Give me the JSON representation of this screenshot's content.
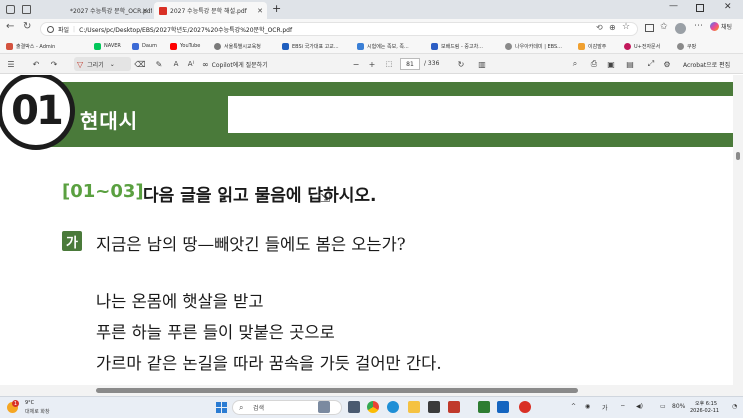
{
  "browser": {
    "tabs": [
      {
        "title": "*2027 수능특강 문학_OCR.pdf",
        "active": false
      },
      {
        "title": "2027 수능특강 문학 해설.pdf",
        "active": true
      }
    ],
    "new_tab": "+",
    "url_prefix": "파일",
    "url": "C:/Users/pc/Desktop/EBS/2027학년도/2027%20수능특강%20문학_OCR.pdf",
    "right_label": "채팅",
    "bookmarks": [
      {
        "label": "출결박스 - Admin",
        "color": "#d4533f"
      },
      {
        "label": "NAVER",
        "color": "#03c75a"
      },
      {
        "label": "Daum",
        "color": "#3d6bd6"
      },
      {
        "label": "YouTube",
        "color": "#ff0000"
      },
      {
        "label": "서울특별시교육청",
        "color": "#7a7a7a"
      },
      {
        "label": "EBSi 국가대표 고교...",
        "color": "#1f5fbf"
      },
      {
        "label": "시험에는 족보, 족...",
        "color": "#3a7fd6"
      },
      {
        "label": "보배드림 - 중고차...",
        "color": "#2c5ec4"
      },
      {
        "label": "나우아카데미 | EBS...",
        "color": "#8a8a8a"
      },
      {
        "label": "이감발주",
        "color": "#f0a030"
      },
      {
        "label": "U+전자문서",
        "color": "#c2185b"
      },
      {
        "label": "쿠팡",
        "color": "#8a8a8a"
      }
    ]
  },
  "pdf_toolbar": {
    "draw_label": "그리기",
    "copilot_label": "Copilot에게 질문하기",
    "zoom_minus": "−",
    "zoom_plus": "+",
    "page_current": "81",
    "page_total": "/ 336",
    "acrobat_label": "Acrobat으로 편집"
  },
  "document": {
    "section_number": "01",
    "section_title": "현대시",
    "question_range": "[01~03]",
    "question_text": "다음 글을 읽고 물음에 답하시오.",
    "passage_badge": "가",
    "poem_lines": [
      "지금은 남의 땅—빼앗긴 들에도 봄은 오는가?",
      "나는 온몸에 햇살을 받고",
      "푸른 하늘 푸른 들이 맞붙은 곳으로",
      "가르마 같은 논길을 따라 꿈속을 가듯 걸어만 간다."
    ]
  },
  "taskbar": {
    "weather_temp": "9°C",
    "weather_desc": "대체로 화창",
    "weather_badge": "1",
    "search_placeholder": "검색",
    "time": "오후 6:15",
    "date": "2026-02-11",
    "battery": "80%",
    "lang": "가"
  }
}
